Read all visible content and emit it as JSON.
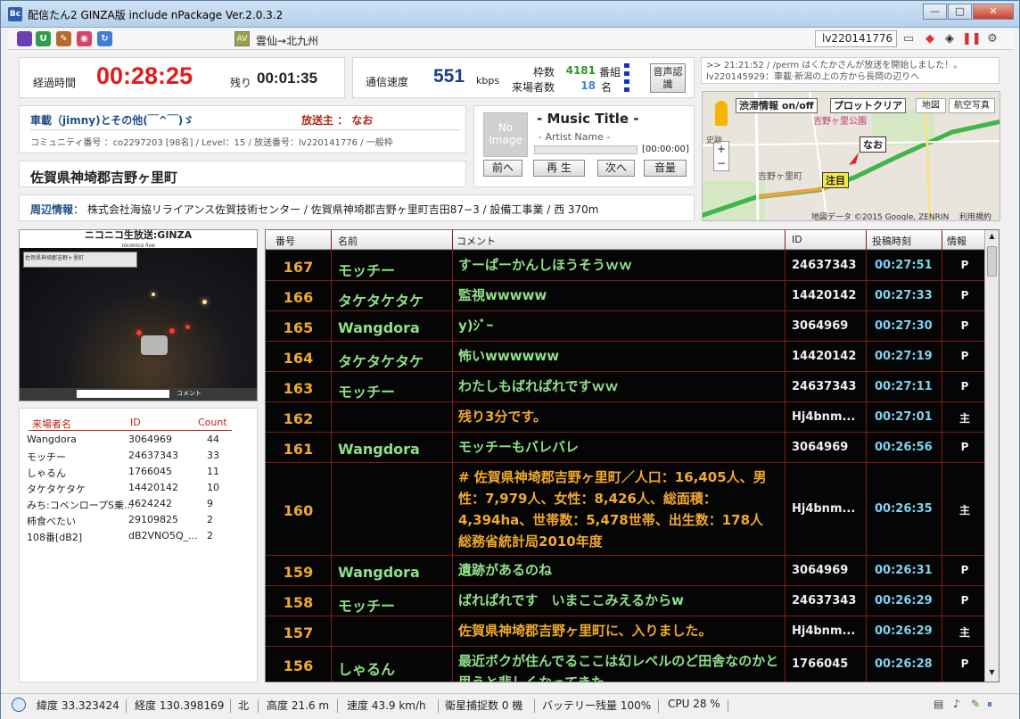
{
  "window": {
    "title": "配信たん2 GINZA版 include nPackage Ver.2.0.3.2",
    "app_icon": "Bc",
    "minimize": "—",
    "maximize": "□",
    "close": "✕"
  },
  "toolbar": {
    "route_icon": "AV",
    "route": "雲仙→北九州",
    "live_id": "lv220141776"
  },
  "timer": {
    "elapsed_label": "経過時間",
    "elapsed": "00:28:25",
    "remain_label": "残り",
    "remain": "00:01:35"
  },
  "connection": {
    "speed_label": "通信速度",
    "speed": "551",
    "speed_unit": "kbps",
    "slot_label": "枠数",
    "slot_value": "4181",
    "slot_unit": "番組",
    "visitors_label": "来場者数",
    "visitors_value": "18",
    "visitors_unit": "名",
    "voice_button": "音声認識"
  },
  "log": {
    "line1": ">> 21:21:52 / /perm はくたかさんが放送を開始しました！。",
    "line2": "lv220145929：車載·新潟の上の方から長岡の辺りへ"
  },
  "broadcast": {
    "title": "車載（jimny)とその他(￣^￣)ゞ",
    "host": "放送主 ： なお",
    "details": "コミュニティ番号 ：co2297203 [98名] / Level：15 / 放送番号：lv220141776 / 一般枠"
  },
  "location": {
    "address": "佐賀県神埼郡吉野ヶ里町",
    "nearby_label": "周辺情報",
    "nearby": "：  株式会社海協リライアンス佐賀技術センター / 佐賀県神埼郡吉野ヶ里町吉田87−3 / 設備工事業 / 西 370m"
  },
  "music": {
    "thumb": "No Image",
    "title": "- Music Title -",
    "artist": "- Artist Name -",
    "progress": 0,
    "time": "[00:00:00]",
    "prev": "前へ",
    "play": "再 生",
    "next": "次へ",
    "volume": "音量"
  },
  "map": {
    "traffic_btn": "渋滞情報 on/off",
    "plot_clear": "プロットクリア",
    "tab_map": "地図",
    "tab_sat": "航空写真",
    "park": "吉野ヶ里公園",
    "station": "吉野ヶ里町",
    "area": "史跡",
    "marker_name": "なお",
    "marker_note": "注目",
    "copyright": "地図データ ©2015 Google, ZENRIN",
    "terms": "利用規約",
    "zoom_in": "+",
    "zoom_out": "−"
  },
  "video": {
    "header": "ニコニコ生放送:GINZA",
    "sub": "niconico live",
    "overlay": "佐賀県神埼郡吉野ヶ里町",
    "comment_label": "コメント"
  },
  "visitors": {
    "headers": [
      "来場者名",
      "ID",
      "Count"
    ],
    "rows": [
      [
        "Wangdora",
        "3064969",
        "44"
      ],
      [
        "モッチー",
        "24637343",
        "33"
      ],
      [
        "しゃるん",
        "1766045",
        "11"
      ],
      [
        "タケタケタケ",
        "14420142",
        "10"
      ],
      [
        "みち:コベンロープS乗...",
        "4624242",
        "9"
      ],
      [
        "柿食べたい",
        "29109825",
        "2"
      ],
      [
        "108番[dB2]",
        "dB2VNO5Q_...",
        "2"
      ]
    ]
  },
  "comments": {
    "headers": [
      "番号",
      "名前",
      "コメント",
      "ID",
      "投稿時刻",
      "情報"
    ],
    "rows": [
      {
        "no": "167",
        "name": "モッチー",
        "text": "すーぱーかんしほうそうｗｗ",
        "id": "24637343",
        "time": "00:27:51",
        "info": "P",
        "color": "#8fe08a"
      },
      {
        "no": "166",
        "name": "タケタケタケ",
        "text": "監視wwwww",
        "id": "14420142",
        "time": "00:27:33",
        "info": "P",
        "color": "#8fe08a"
      },
      {
        "no": "165",
        "name": "Wangdora",
        "text": "y)ｼﾞｰ",
        "id": "3064969",
        "time": "00:27:30",
        "info": "P",
        "color": "#8fe08a"
      },
      {
        "no": "164",
        "name": "タケタケタケ",
        "text": "怖いwwwwww",
        "id": "14420142",
        "time": "00:27:19",
        "info": "P",
        "color": "#8fe08a"
      },
      {
        "no": "163",
        "name": "モッチー",
        "text": "わたしもばれぱれですｗｗ",
        "id": "24637343",
        "time": "00:27:11",
        "info": "P",
        "color": "#8fe08a"
      },
      {
        "no": "162",
        "name": "",
        "text": "残り3分です。",
        "id": "Hj4bnm...",
        "time": "00:27:01",
        "info": "主",
        "color": "#f0a82e"
      },
      {
        "no": "161",
        "name": "Wangdora",
        "text": "モッチーもバレバレ",
        "id": "3064969",
        "time": "00:26:56",
        "info": "P",
        "color": "#8fe08a"
      },
      {
        "no": "160",
        "name": "",
        "text": "# 佐賀県神埼郡吉野ヶ里町／人口：16,405人、男性：7,979人、女性：8,426人、総面積：4,394ha、世帯数：5,478世帯、出生数：178人　総務省統計局2010年度",
        "id": "Hj4bnm...",
        "time": "00:26:35",
        "info": "主",
        "color": "#f0a82e"
      },
      {
        "no": "159",
        "name": "Wangdora",
        "text": "遺跡があるのね",
        "id": "3064969",
        "time": "00:26:31",
        "info": "P",
        "color": "#8fe08a"
      },
      {
        "no": "158",
        "name": "モッチー",
        "text": "ばれぱれです　いまここみえるからw",
        "id": "24637343",
        "time": "00:26:29",
        "info": "P",
        "color": "#8fe08a"
      },
      {
        "no": "157",
        "name": "",
        "text": "佐賀県神埼郡吉野ヶ里町に、入りました。",
        "id": "Hj4bnm...",
        "time": "00:26:29",
        "info": "主",
        "color": "#f0a82e"
      },
      {
        "no": "156",
        "name": "しゃるん",
        "text": "最近ボクが住んでるここは幻レベルのど田舎なのかと思うと悲しくなってきた",
        "id": "1766045",
        "time": "00:26:28",
        "info": "P",
        "color": "#8fe08a"
      }
    ]
  },
  "status": {
    "lat": "緯度 33.323424",
    "lon": "経度 130.398169",
    "dir": "北",
    "alt": "高度 21.6 m",
    "speed": "速度 43.9 km/h",
    "sats": "衛星捕捉数 0 機",
    "battery": "バッテリー残量 100%",
    "cpu": "CPU 28 %"
  }
}
